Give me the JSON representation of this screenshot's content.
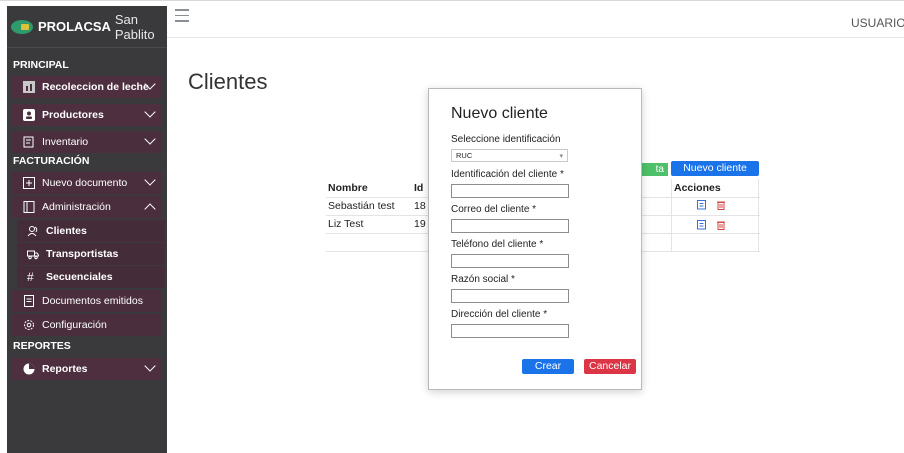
{
  "brand": {
    "name": "PROLACSA",
    "location": "San Pablito"
  },
  "topbar": {
    "user": "USUARIO"
  },
  "sidebar": {
    "sections": {
      "principal": "PRINCIPAL",
      "facturacion": "FACTURACIÓN",
      "reportes": "REPORTES"
    },
    "items": {
      "recoleccion": "Recoleccion de leche",
      "productores": "Productores",
      "inventario": "Inventario",
      "nuevo_documento": "Nuevo documento",
      "administracion": "Administración",
      "clientes": "Clientes",
      "transportistas": "Transportistas",
      "secuenciales": "Secuenciales",
      "documentos_emitidos": "Documentos emitidos",
      "configuracion": "Configuración",
      "reportes": "Reportes"
    }
  },
  "page": {
    "title": "Clientes"
  },
  "actions": {
    "green_partial": "ta",
    "new_client": "Nuevo cliente"
  },
  "table": {
    "headers": {
      "name": "Nombre",
      "id": "Id",
      "actions": "Acciones"
    },
    "rows": [
      {
        "name": "Sebastián test",
        "id": "18"
      },
      {
        "name": "Liz Test",
        "id": "19"
      }
    ]
  },
  "modal": {
    "title": "Nuevo cliente",
    "select_label": "Seleccione identificación",
    "select_value": "RUC",
    "fields": {
      "identificacion": "Identificación del cliente *",
      "correo": "Correo del cliente *",
      "telefono": "Teléfono del cliente *",
      "razon": "Razón social *",
      "direccion": "Dirección del cliente *"
    },
    "buttons": {
      "create": "Crear",
      "cancel": "Cancelar"
    }
  },
  "colors": {
    "primary": "#1a73e8",
    "danger": "#dc3545",
    "success": "#4fc06a",
    "sidebar": "#3a3a3d",
    "sidebar_item": "#4d2f3f"
  }
}
